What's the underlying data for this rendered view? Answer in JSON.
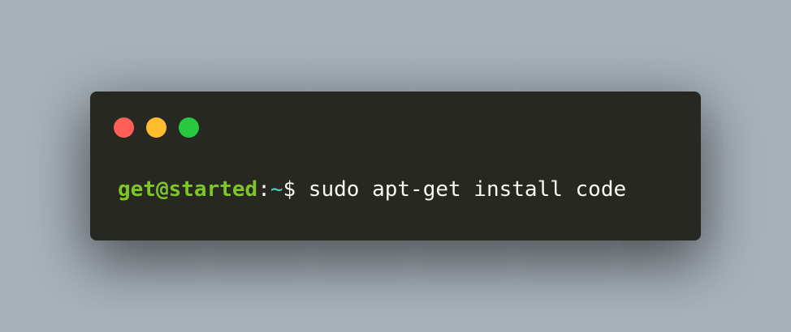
{
  "background_color": "#a9b2bb",
  "terminal": {
    "background_color": "#272822",
    "window_controls": [
      {
        "name": "close",
        "color": "#ff5f56"
      },
      {
        "name": "minimize",
        "color": "#ffbd2e"
      },
      {
        "name": "maximize",
        "color": "#27c93f"
      }
    ],
    "prompt": {
      "user_host": "get@started",
      "user_host_color": "#7ec626",
      "separator": ":",
      "path": "~",
      "path_color": "#48d7b9",
      "symbol": "$",
      "command": " sudo apt-get install code",
      "text_color": "#f8f8f2"
    }
  }
}
